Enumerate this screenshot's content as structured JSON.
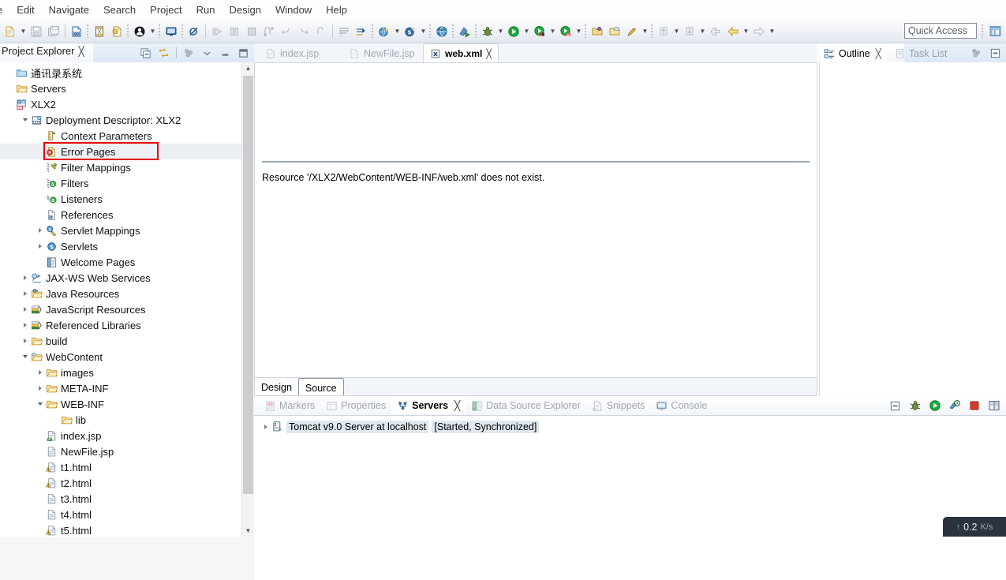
{
  "menu": {
    "items": [
      {
        "label": "e",
        "name": "menu-file"
      },
      {
        "label": "Edit",
        "name": "menu-edit"
      },
      {
        "label": "Navigate",
        "name": "menu-navigate"
      },
      {
        "label": "Search",
        "name": "menu-search"
      },
      {
        "label": "Project",
        "name": "menu-project"
      },
      {
        "label": "Run",
        "name": "menu-run"
      },
      {
        "label": "Design",
        "name": "menu-design"
      },
      {
        "label": "Window",
        "name": "menu-window"
      },
      {
        "label": "Help",
        "name": "menu-help"
      }
    ]
  },
  "toolbar": {
    "quick_access_placeholder": "Quick Access",
    "quick_access_value": ""
  },
  "project_explorer": {
    "title": "Project Explorer",
    "close_glyph": "╳",
    "tree": [
      {
        "label": "通讯录系统",
        "indent": 0,
        "twisty": "none",
        "icon": "folder-blue-icon",
        "cjk": true
      },
      {
        "label": "Servers",
        "indent": 0,
        "twisty": "none",
        "icon": "folder-open-icon"
      },
      {
        "label": "XLX2",
        "indent": 0,
        "twisty": "none",
        "icon": "web-project-icon"
      },
      {
        "label": "Deployment Descriptor: XLX2",
        "indent": 1,
        "twisty": "down",
        "icon": "deployment-descriptor-icon"
      },
      {
        "label": "Context Parameters",
        "indent": 2,
        "twisty": "none",
        "icon": "context-parameters-icon"
      },
      {
        "label": "Error Pages",
        "indent": 2,
        "twisty": "none",
        "icon": "error-pages-icon",
        "highlighted": true,
        "selected": true
      },
      {
        "label": "Filter Mappings",
        "indent": 2,
        "twisty": "none",
        "icon": "filter-mappings-icon"
      },
      {
        "label": "Filters",
        "indent": 2,
        "twisty": "none",
        "icon": "filters-icon"
      },
      {
        "label": "Listeners",
        "indent": 2,
        "twisty": "none",
        "icon": "listeners-icon"
      },
      {
        "label": "References",
        "indent": 2,
        "twisty": "none",
        "icon": "references-icon"
      },
      {
        "label": "Servlet Mappings",
        "indent": 2,
        "twisty": "right",
        "icon": "servlet-mappings-icon"
      },
      {
        "label": "Servlets",
        "indent": 2,
        "twisty": "right",
        "icon": "servlets-icon"
      },
      {
        "label": "Welcome Pages",
        "indent": 2,
        "twisty": "none",
        "icon": "welcome-pages-icon"
      },
      {
        "label": "JAX-WS Web Services",
        "indent": 1,
        "twisty": "right",
        "icon": "jaxws-icon"
      },
      {
        "label": "Java Resources",
        "indent": 1,
        "twisty": "right",
        "icon": "java-resources-icon"
      },
      {
        "label": "JavaScript Resources",
        "indent": 1,
        "twisty": "right",
        "icon": "js-resources-icon"
      },
      {
        "label": "Referenced Libraries",
        "indent": 1,
        "twisty": "right",
        "icon": "referenced-libraries-icon"
      },
      {
        "label": "build",
        "indent": 1,
        "twisty": "right",
        "icon": "folder-open-icon"
      },
      {
        "label": "WebContent",
        "indent": 1,
        "twisty": "down",
        "icon": "webcontent-folder-icon"
      },
      {
        "label": "images",
        "indent": 2,
        "twisty": "right",
        "icon": "folder-open-icon"
      },
      {
        "label": "META-INF",
        "indent": 2,
        "twisty": "right",
        "icon": "folder-open-icon"
      },
      {
        "label": "WEB-INF",
        "indent": 2,
        "twisty": "down",
        "icon": "folder-open-icon"
      },
      {
        "label": "lib",
        "indent": 3,
        "twisty": "none",
        "icon": "folder-open-icon"
      },
      {
        "label": "index.jsp",
        "indent": 2,
        "twisty": "none",
        "icon": "jsp-file-icon"
      },
      {
        "label": "NewFile.jsp",
        "indent": 2,
        "twisty": "none",
        "icon": "file-icon"
      },
      {
        "label": "t1.html",
        "indent": 2,
        "twisty": "none",
        "icon": "html-warning-icon"
      },
      {
        "label": "t2.html",
        "indent": 2,
        "twisty": "none",
        "icon": "html-warning-icon"
      },
      {
        "label": "t3.html",
        "indent": 2,
        "twisty": "none",
        "icon": "file-icon"
      },
      {
        "label": "t4.html",
        "indent": 2,
        "twisty": "none",
        "icon": "file-icon"
      },
      {
        "label": "t5.html",
        "indent": 2,
        "twisty": "none",
        "icon": "html-warning-icon"
      }
    ]
  },
  "editor": {
    "tabs": [
      {
        "label": "index.jsp",
        "active": false,
        "icon": "jsp-file-icon",
        "name": "editor-tab-index-jsp"
      },
      {
        "label": "NewFile.jsp",
        "active": false,
        "icon": "file-icon",
        "name": "editor-tab-newfile-jsp"
      },
      {
        "label": "web.xml",
        "active": true,
        "icon": "xml-file-icon",
        "name": "editor-tab-web-xml",
        "close_glyph": "╳"
      }
    ],
    "message": "Resource '/XLX2/WebContent/WEB-INF/web.xml' does not exist.",
    "bottom_tabs": [
      {
        "label": "Design",
        "selected": false,
        "name": "editor-design-tab"
      },
      {
        "label": "Source",
        "selected": true,
        "name": "editor-source-tab"
      }
    ]
  },
  "outline": {
    "tabs": [
      {
        "label": "Outline",
        "active": true,
        "icon": "outline-icon",
        "close_glyph": "╳"
      },
      {
        "label": "Task List",
        "active": false,
        "icon": "task-list-icon"
      }
    ]
  },
  "bottom_panel": {
    "tabs": [
      {
        "label": "Markers",
        "active": false,
        "icon": "markers-icon"
      },
      {
        "label": "Properties",
        "active": false,
        "icon": "properties-icon"
      },
      {
        "label": "Servers",
        "active": true,
        "icon": "servers-icon",
        "close_glyph": "╳"
      },
      {
        "label": "Data Source Explorer",
        "active": false,
        "icon": "data-source-explorer-icon"
      },
      {
        "label": "Snippets",
        "active": false,
        "icon": "snippets-icon"
      },
      {
        "label": "Console",
        "active": false,
        "icon": "console-icon"
      }
    ],
    "servers": [
      {
        "name_text": "Tomcat v9.0 Server at localhost",
        "status": "[Started, Synchronized]",
        "twisty": "right"
      }
    ]
  },
  "net_speed": {
    "arrow": "↑",
    "value": "0.2",
    "unit": "K/s"
  }
}
